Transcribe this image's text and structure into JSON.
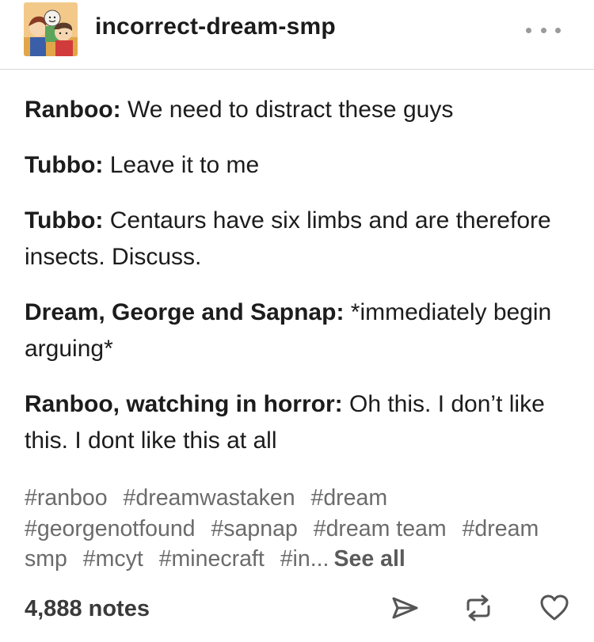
{
  "header": {
    "blog_name": "incorrect-dream-smp",
    "avatar_icon": "group-portrait-avatar",
    "menu_icon": "more-horizontal-icon"
  },
  "post": {
    "lines": [
      {
        "speaker": "Ranboo:",
        "text": " We need to distract these guys"
      },
      {
        "speaker": "Tubbo:",
        "text": " Leave it to me"
      },
      {
        "speaker": "Tubbo:",
        "text": " Centaurs have six limbs and are therefore insects. Discuss."
      },
      {
        "speaker": "Dream, George and Sapnap:",
        "text": " *immediately begin arguing*"
      },
      {
        "speaker": "Ranboo, watching in horror:",
        "text": " Oh this. I don’t like this. I dont like this at all"
      }
    ]
  },
  "tags": {
    "items": [
      "#ranboo",
      "#dreamwastaken",
      "#dream",
      "#georgenotfound",
      "#sapnap",
      "#dream team",
      "#dream smp",
      "#mcyt",
      "#minecraft",
      "#in..."
    ],
    "see_all": "See all"
  },
  "footer": {
    "notes": "4,888 notes",
    "icons": [
      "share-icon",
      "reblog-icon",
      "like-heart-icon"
    ]
  },
  "colors": {
    "text": "#1c1c1c",
    "tags": "#6b6b6b",
    "divider": "#d9d9d9"
  }
}
